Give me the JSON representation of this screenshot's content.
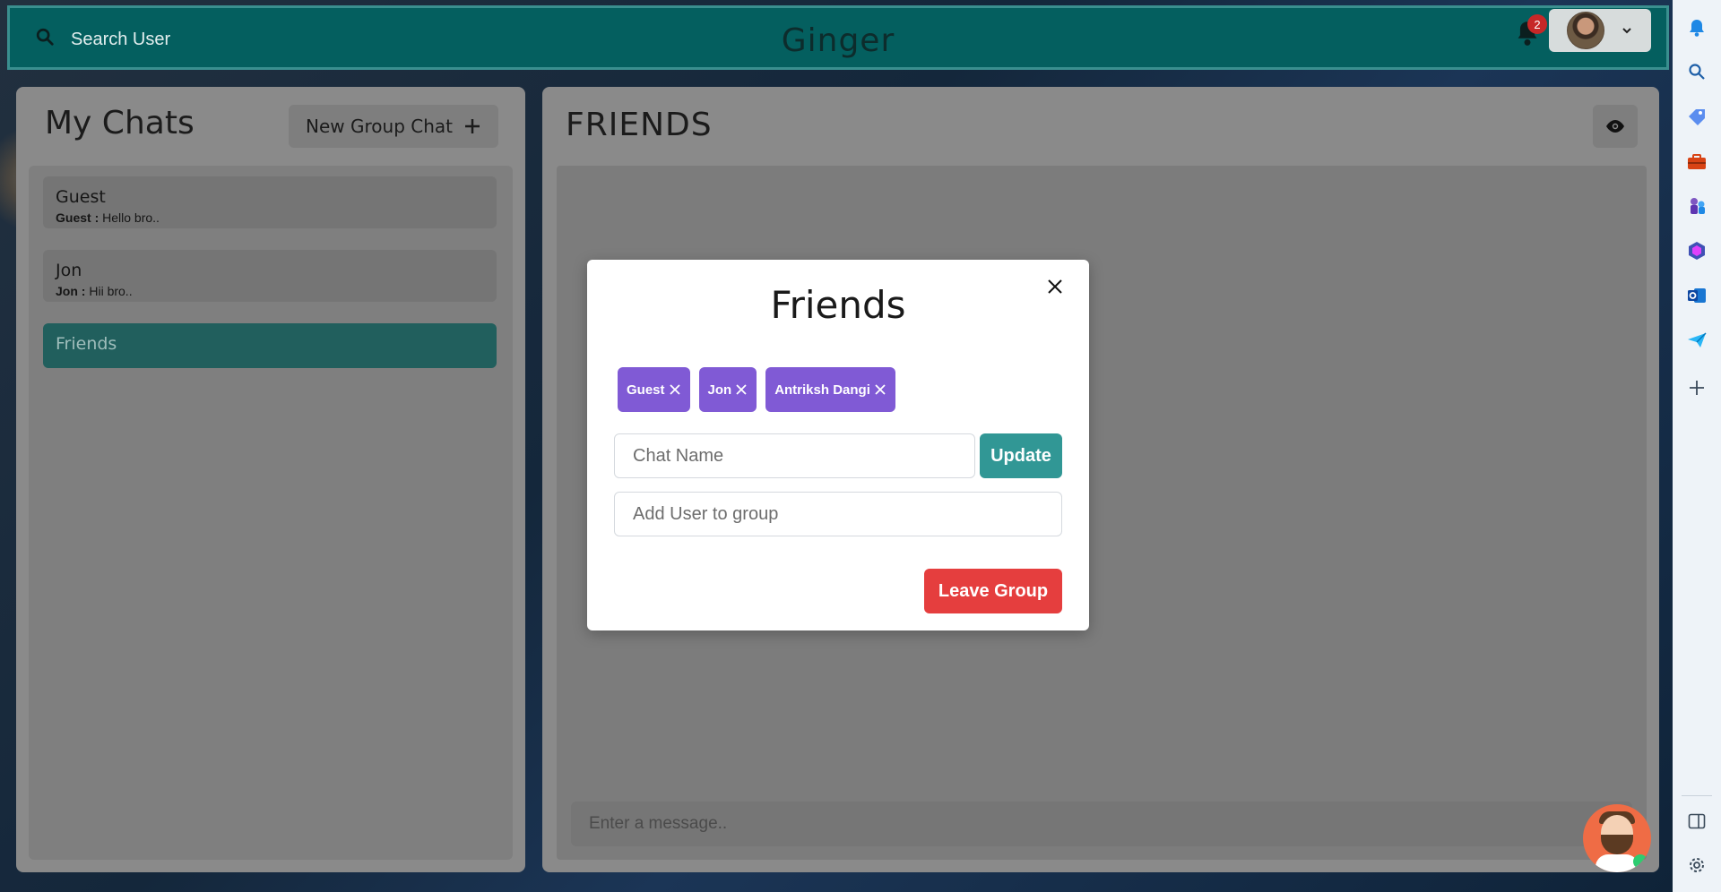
{
  "header": {
    "search_label": "Search User",
    "app_title": "Ginger",
    "notification_count": "2",
    "icons": [
      "search-icon",
      "bell-icon",
      "chevron-down-icon"
    ],
    "accent_color": "#045f5f"
  },
  "sidebar": {
    "title": "My Chats",
    "new_group_label": "New Group Chat",
    "chats": [
      {
        "name": "Guest",
        "sender": "Guest :",
        "message": "Hello bro.."
      },
      {
        "name": "Jon",
        "sender": "Jon :",
        "message": "Hii bro.."
      },
      {
        "name": "Friends",
        "active": true
      }
    ],
    "active_color": "#215f5d"
  },
  "chat": {
    "title": "FRIENDS",
    "message_placeholder": "Enter a message.."
  },
  "modal": {
    "title": "Friends",
    "members": [
      "Guest",
      "Jon",
      "Antriksh Dangi"
    ],
    "chat_name_placeholder": "Chat Name",
    "update_label": "Update",
    "add_user_placeholder": "Add User to group",
    "leave_label": "Leave Group",
    "chip_color": "#805ad5",
    "update_color": "#319795",
    "leave_color": "#e53e3e"
  },
  "browser_sidebar": {
    "icons": [
      "bell-icon",
      "search-icon",
      "tag-icon",
      "briefcase-icon",
      "chess-icon",
      "copilot-icon",
      "outlook-icon",
      "send-icon",
      "plus-icon",
      "panel-icon",
      "gear-icon"
    ]
  }
}
